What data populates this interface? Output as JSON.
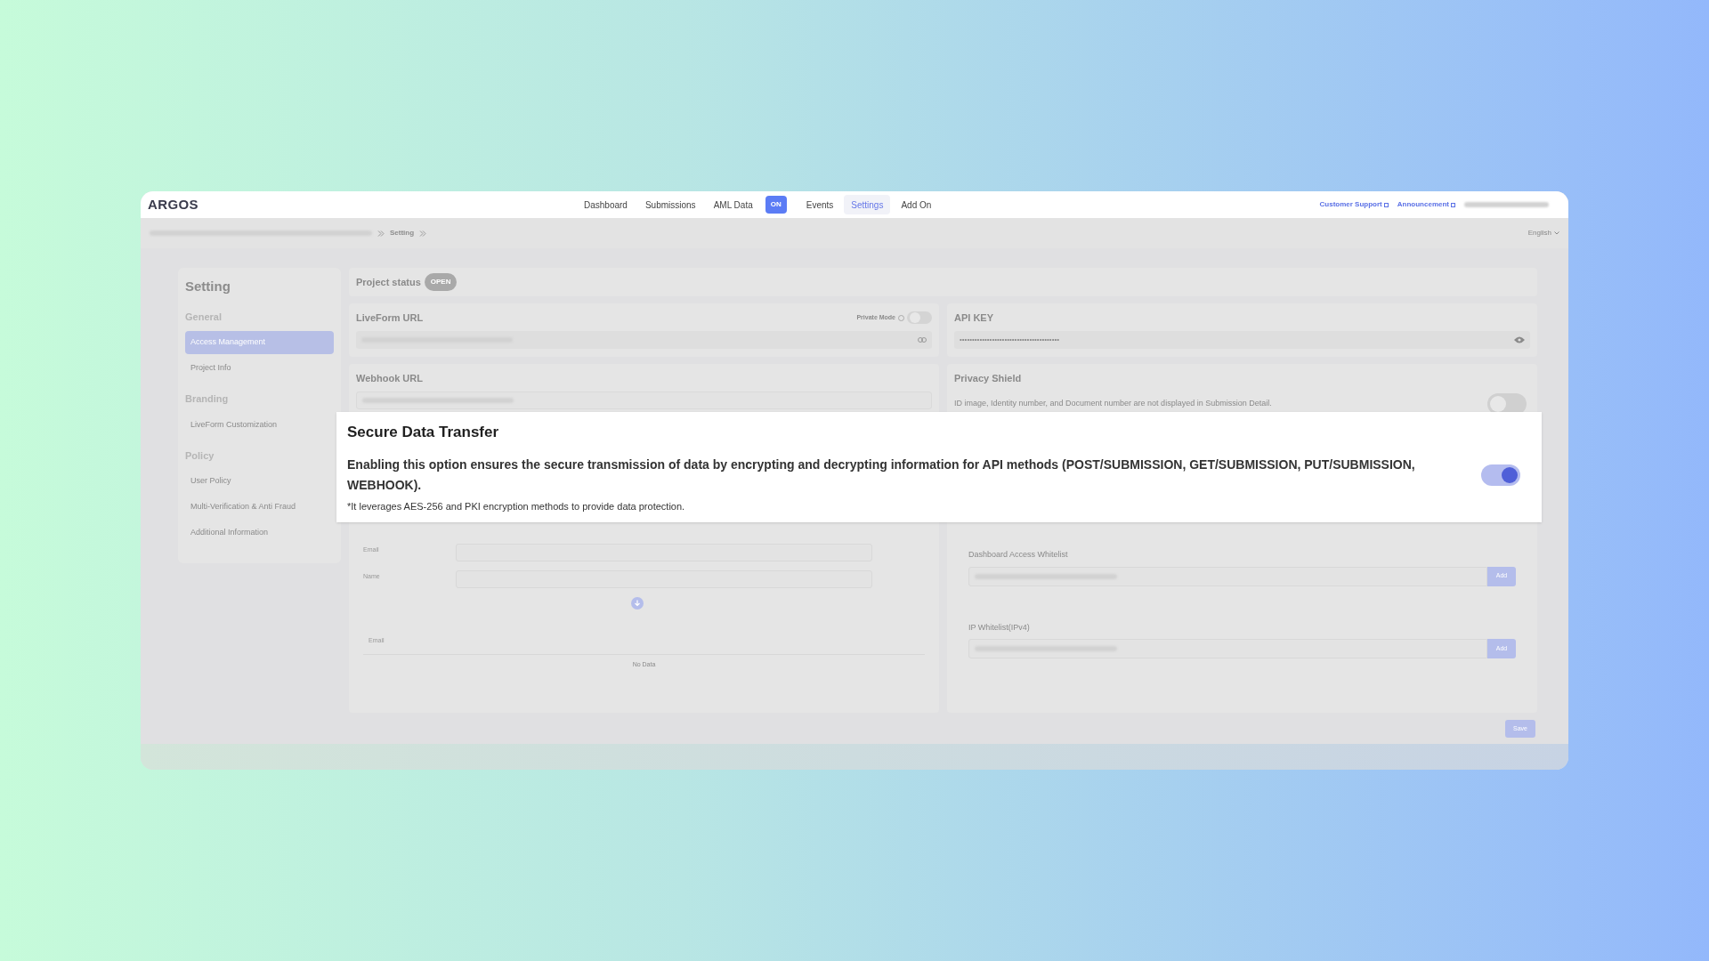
{
  "brand": "ARGOS",
  "nav": [
    {
      "label": "Dashboard",
      "selected": false
    },
    {
      "label": "Submissions",
      "selected": false
    },
    {
      "label": "AML Data",
      "selected": false,
      "badge": "ON"
    },
    {
      "label": "Events",
      "selected": false
    },
    {
      "label": "Settings",
      "selected": true
    },
    {
      "label": "Add On",
      "selected": false
    }
  ],
  "nav_links": [
    "Customer Support",
    "Announcement"
  ],
  "breadcrumb": "Setting",
  "language": "English",
  "sidebar": {
    "title": "Setting",
    "sections": [
      {
        "heading": "General",
        "items": [
          {
            "label": "Access Management",
            "selected": true
          },
          {
            "label": "Project Info",
            "selected": false
          }
        ]
      },
      {
        "heading": "Branding",
        "items": [
          {
            "label": "LiveForm Customization",
            "selected": false
          }
        ]
      },
      {
        "heading": "Policy",
        "items": [
          {
            "label": "User Policy",
            "selected": false
          },
          {
            "label": "Multi-Verification & Anti Fraud",
            "selected": false
          },
          {
            "label": "Additional Information",
            "selected": false
          }
        ]
      }
    ]
  },
  "project_status": {
    "label": "Project status",
    "badge": "OPEN"
  },
  "liveform": {
    "title": "LiveForm URL",
    "private_mode": {
      "label": "Private Mode",
      "on": false
    }
  },
  "api_key": {
    "title": "API KEY",
    "value": "••••••••••••••••••••••••••••••••••••••••"
  },
  "webhook": {
    "title": "Webhook URL"
  },
  "privacy_shield": {
    "title": "Privacy Shield",
    "description": "ID image, Identity number, and Document number are not displayed in Submission Detail.",
    "on": false
  },
  "secure_transfer": {
    "title": "Secure Data Transfer",
    "description": "Enabling this option ensures the secure transmission of data by encrypting and decrypting information for API methods (POST/SUBMISSION, GET/SUBMISSION, PUT/SUBMISSION, WEBHOOK).",
    "note": "*It leverages AES-256 and PKI encryption methods to provide data protection.",
    "on": true
  },
  "access_form": {
    "fields": [
      "Email",
      "Name"
    ],
    "table_column": "Email",
    "empty": "No Data"
  },
  "whitelists": [
    {
      "label": "Dashboard Access Whitelist",
      "button": "Add"
    },
    {
      "label": "IP Whitelist(IPv4)",
      "button": "Add"
    }
  ],
  "save": "Save"
}
